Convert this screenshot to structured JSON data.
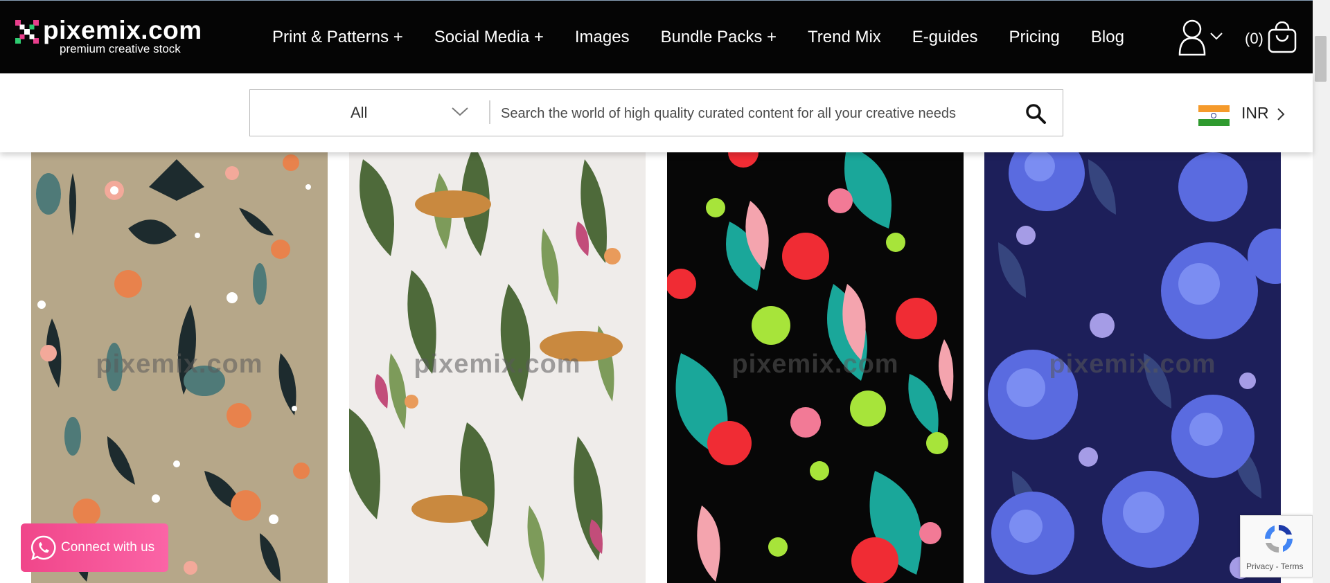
{
  "brand": {
    "name": "pixemix.com",
    "tagline": "premium creative stock",
    "accent_colors": [
      "#e83e8c",
      "#2ecc71",
      "#ffffff"
    ]
  },
  "nav": {
    "items": [
      {
        "label": "Print & Patterns +"
      },
      {
        "label": "Social Media +"
      },
      {
        "label": "Images"
      },
      {
        "label": "Bundle Packs +"
      },
      {
        "label": "Trend Mix"
      },
      {
        "label": "E-guides"
      },
      {
        "label": "Pricing"
      },
      {
        "label": "Blog"
      }
    ],
    "user_icon": "user-icon",
    "cart": {
      "count_label": "(0)",
      "icon": "shopping-bag-icon"
    }
  },
  "search": {
    "category_selected": "All",
    "placeholder": "Search the world of high quality curated content for all your creative needs",
    "button_icon": "search-icon"
  },
  "currency": {
    "code": "INR",
    "flag": "india-flag-icon"
  },
  "grid": {
    "tiles": [
      {
        "watermark": "pixemix.com",
        "theme": "tropical floral on beige",
        "bg": "#b6a789"
      },
      {
        "watermark": "pixemix.com",
        "theme": "leopards among tropical leaves on white",
        "bg": "#efecea"
      },
      {
        "watermark": "pixemix.com",
        "theme": "bright tropical flowers on black",
        "bg": "#070707"
      },
      {
        "watermark": "pixemix.com",
        "theme": "blue hydrangeas on navy",
        "bg": "#1d1f5a"
      }
    ]
  },
  "connect_widget": {
    "label": "Connect with us",
    "icon": "whatsapp-icon"
  },
  "recaptcha": {
    "links": "Privacy - Terms"
  }
}
